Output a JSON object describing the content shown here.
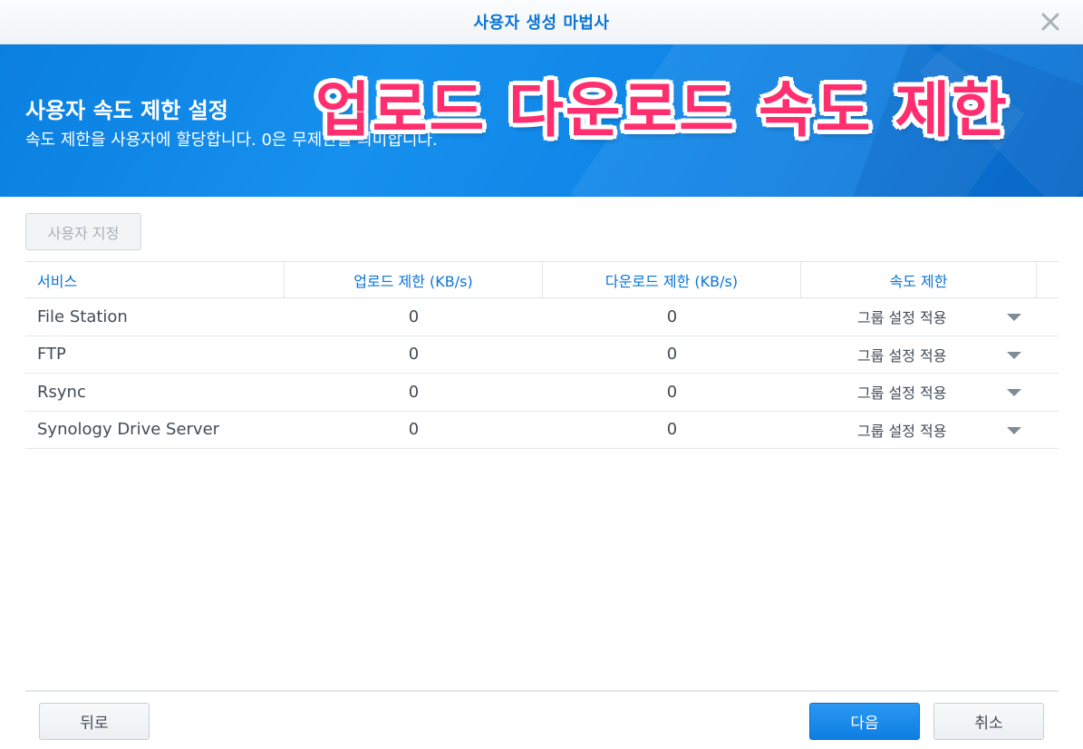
{
  "window": {
    "title": "사용자 생성 마법사"
  },
  "banner": {
    "heading": "사용자 속도 제한 설정",
    "description": "속도 제한을 사용자에 할당합니다. 0은 무제한을 의미합니다.",
    "overlay_caption": "업로드 다운로드 속도 제한"
  },
  "toolbar": {
    "custom_label": "사용자 지정"
  },
  "table": {
    "columns": [
      "서비스",
      "업로드 제한 (KB/s)",
      "다운로드 제한 (KB/s)",
      "속도 제한"
    ],
    "rows": [
      {
        "service": "File Station",
        "upload": "0",
        "download": "0",
        "limit": "그룹 설정 적용"
      },
      {
        "service": "FTP",
        "upload": "0",
        "download": "0",
        "limit": "그룹 설정 적용"
      },
      {
        "service": "Rsync",
        "upload": "0",
        "download": "0",
        "limit": "그룹 설정 적용"
      },
      {
        "service": "Synology Drive Server",
        "upload": "0",
        "download": "0",
        "limit": "그룹 설정 적용"
      }
    ]
  },
  "footer": {
    "back_label": "뒤로",
    "next_label": "다음",
    "cancel_label": "취소"
  },
  "colors": {
    "accent": "#0a74d6",
    "overlay_text": "#ff2e6e",
    "banner": "#1690ee"
  },
  "icons": {
    "close": "close-icon",
    "dropdown": "chevron-down-icon"
  }
}
